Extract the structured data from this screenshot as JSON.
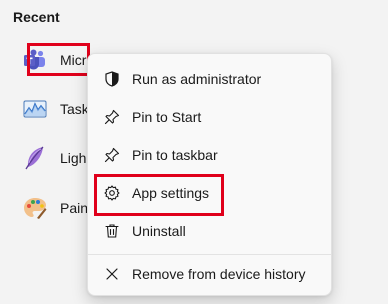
{
  "recent": {
    "title": "Recent",
    "items": [
      {
        "label": "Micr",
        "icon": "teams-icon"
      },
      {
        "label": "Task",
        "icon": "task-manager-icon"
      },
      {
        "label": "Ligh",
        "icon": "lightroom-feather-icon"
      },
      {
        "label": "Pain",
        "icon": "paint-palette-icon"
      }
    ]
  },
  "context_menu": {
    "items": [
      {
        "label": "Run as administrator",
        "icon": "shield-icon"
      },
      {
        "label": "Pin to Start",
        "icon": "pin-icon"
      },
      {
        "label": "Pin to taskbar",
        "icon": "pin-icon"
      },
      {
        "label": "App settings",
        "icon": "gear-icon"
      },
      {
        "label": "Uninstall",
        "icon": "trash-icon"
      },
      {
        "label": "Remove from device history",
        "icon": "close-icon"
      }
    ]
  },
  "colors": {
    "highlight": "#e0001b",
    "teams_purple": "#5b5fc7",
    "menu_bg": "#f9f9f9",
    "page_bg": "#f3f3f3"
  }
}
